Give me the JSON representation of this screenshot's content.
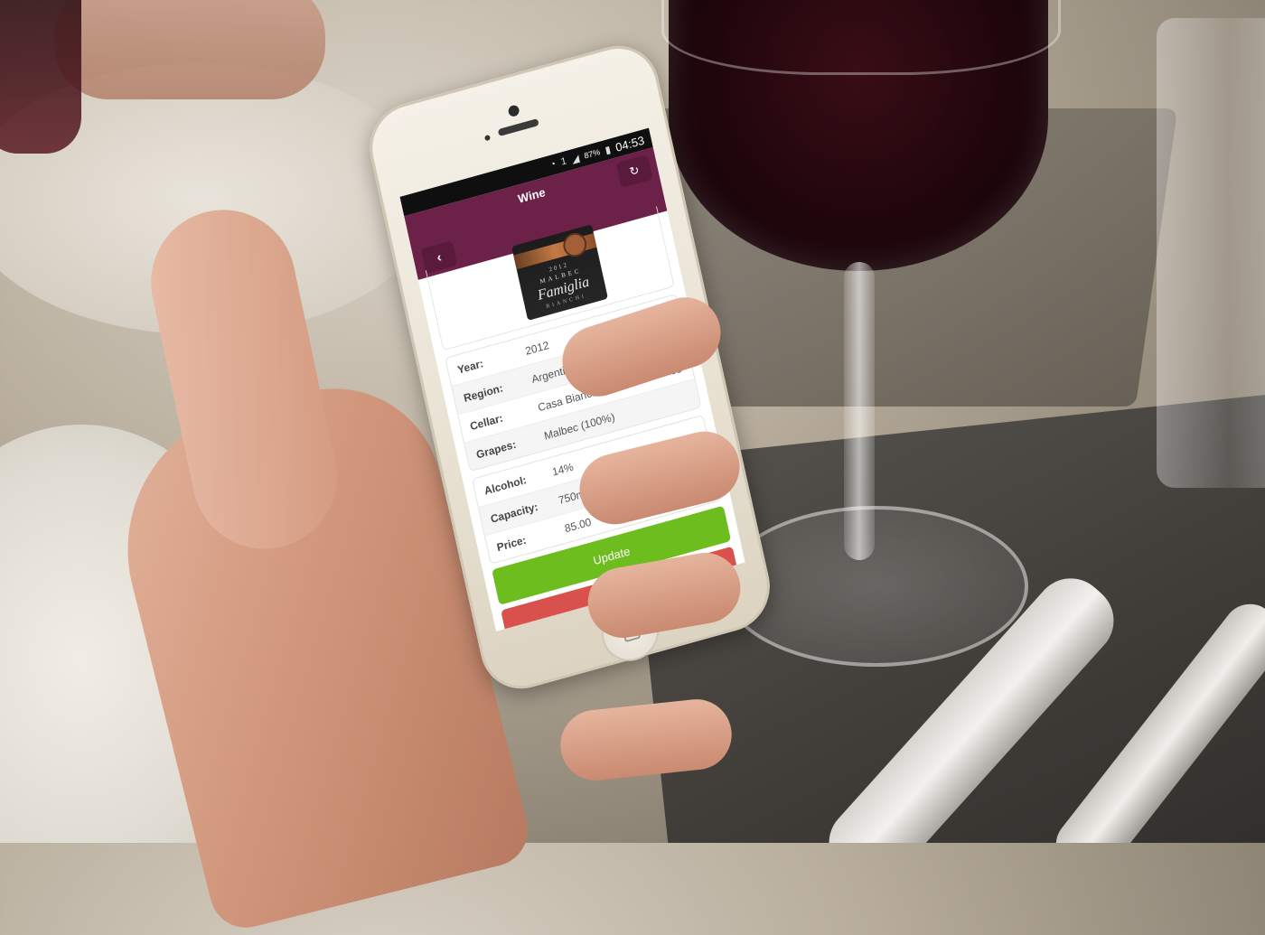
{
  "status_bar": {
    "wifi_icon": "wifi-icon",
    "sim_label": "1",
    "signal_icon": "signal-icon",
    "battery": "87%",
    "battery_icon": "battery-icon",
    "time": "04:53"
  },
  "app_bar": {
    "title": "Wine",
    "refresh_icon": "refresh-icon",
    "back_icon": "chevron-left-icon",
    "color": "#6b2148"
  },
  "wine_image": {
    "label_year": "2012",
    "label_variety": "MALBEC",
    "label_name": "Famiglia",
    "label_sub": "BIANCHI"
  },
  "details": [
    {
      "label": "Year:",
      "value": "2012"
    },
    {
      "label": "Region:",
      "value": "Argentina, San Rafael"
    },
    {
      "label": "Cellar:",
      "value": "Casa Bianchi Familia De Vinos"
    },
    {
      "label": "Grapes:",
      "value": "Malbec (100%)"
    }
  ],
  "specs": [
    {
      "label": "Alcohol:",
      "value": "14%"
    },
    {
      "label": "Capacity:",
      "value": "750ml"
    },
    {
      "label": "Price:",
      "value": "85.00"
    }
  ],
  "actions": {
    "update_label": "Update",
    "update_color": "#6dbd1f",
    "remove_label": "Remove",
    "remove_icon": "trash-icon",
    "remove_color": "#d9514d"
  }
}
